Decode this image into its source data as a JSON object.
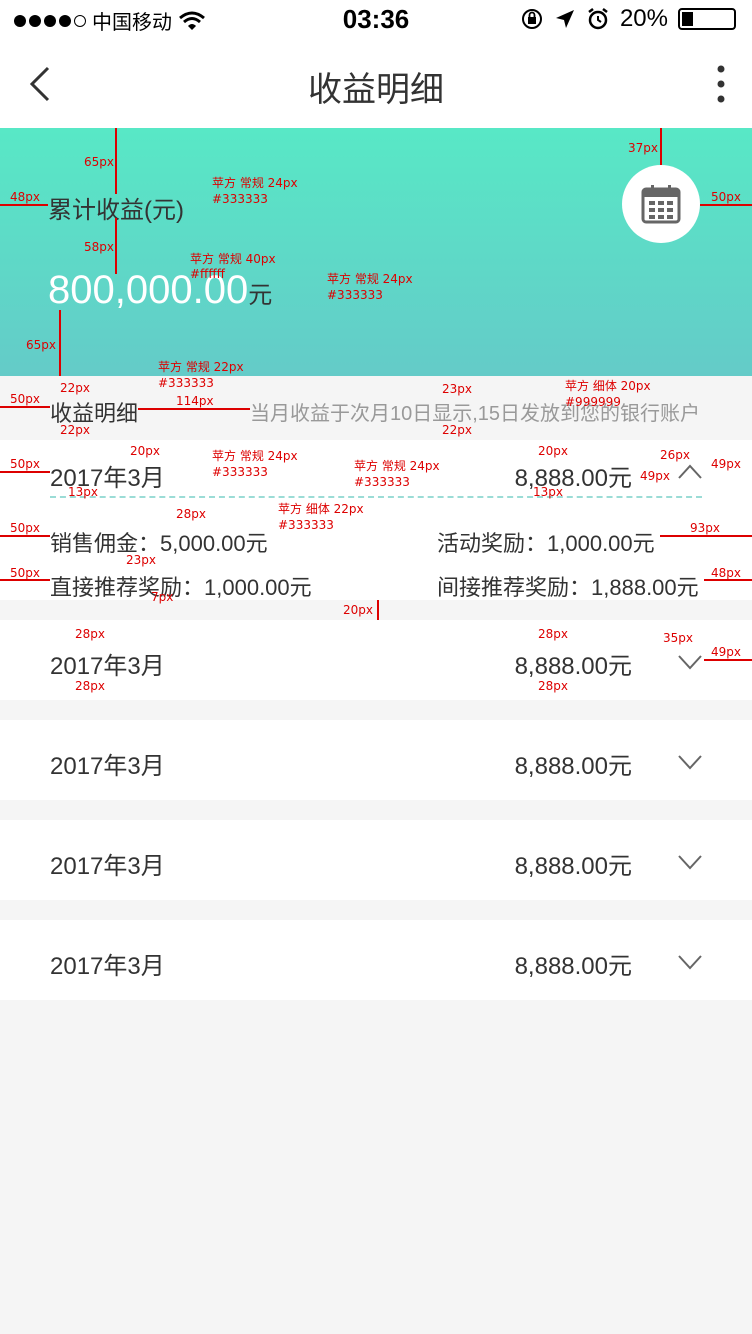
{
  "status": {
    "carrier": "中国移动",
    "time": "03:36",
    "battery": "20%"
  },
  "nav": {
    "title": "收益明细"
  },
  "hero": {
    "label": "累计收益(元)",
    "amount": "800,000.00",
    "unit": "元"
  },
  "notice": {
    "title": "收益明细",
    "desc": "当月收益于次月10日显示,15日发放到您的银行账户"
  },
  "expanded": {
    "month": "2017年3月",
    "total": "8,888.00元",
    "details": [
      {
        "label": "销售佣金：",
        "value": "5,000.00元"
      },
      {
        "label": "活动奖励：",
        "value": "1,000.00元"
      },
      {
        "label": "直接推荐奖励：",
        "value": "1,000.00元"
      },
      {
        "label": "间接推荐奖励：",
        "value": "1,888.00元"
      }
    ]
  },
  "collapsed": [
    {
      "month": "2017年3月",
      "total": "8,888.00元"
    },
    {
      "month": "2017年3月",
      "total": "8,888.00元"
    },
    {
      "month": "2017年3月",
      "total": "8,888.00元"
    },
    {
      "month": "2017年3月",
      "total": "8,888.00元"
    }
  ],
  "annotations": {
    "a65": "65px",
    "a37": "37px",
    "a48": "48px",
    "a50": "50px",
    "a58": "58px",
    "f1": "苹方 常规 24px",
    "c1": "#333333",
    "f2": "苹方 常规 40px",
    "c2": "#ffffff",
    "f3": "苹方 常规 24px",
    "c3": "#333333",
    "a65b": "65px",
    "a22": "22px",
    "a114": "114px",
    "a22b": "22px",
    "f4": "苹方 常规 22px",
    "c4": "#333333",
    "a23": "23px",
    "a22c": "22px",
    "f5": "苹方 细体 20px",
    "c5": "#999999",
    "a50b": "50px",
    "a20": "20px",
    "a13": "13px",
    "f6": "苹方 常规 24px",
    "c6": "#333333",
    "f7": "苹方 常规 24px",
    "c7": "#333333",
    "a20b": "20px",
    "a13b": "13px",
    "a26": "26px",
    "a49": "49px",
    "a49b": "49px",
    "a28": "28px",
    "f8": "苹方 细体 22px",
    "c8": "#333333",
    "a50c": "50px",
    "a93": "93px",
    "a23b": "23px",
    "a50d": "50px",
    "a7": "7px",
    "a48b": "48px",
    "a20c": "20px",
    "a28b": "28px",
    "a28c": "28px",
    "a35": "35px",
    "a49c": "49px",
    "a28d": "28px",
    "a28e": "28px"
  }
}
